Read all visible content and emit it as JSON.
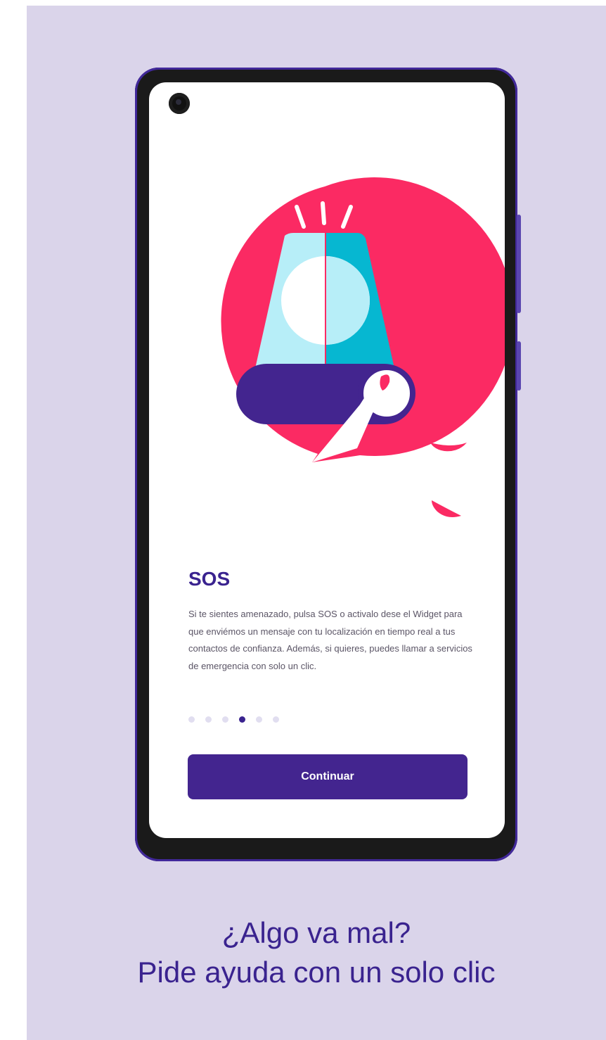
{
  "onboarding": {
    "title": "SOS",
    "description": "Si te sientes amenazado, pulsa SOS o activalo dese el Widget para que enviémos un mensaje con tu localización en tiempo real a tus contactos de confianza. Además, si quieres, puedes llamar a servicios de emergencia con solo un clic.",
    "pagination": {
      "total": 6,
      "current": 4
    },
    "continue_label": "Continuar"
  },
  "caption": {
    "line1": "¿Algo va mal?",
    "line2": "Pide ayuda con un solo clic"
  },
  "colors": {
    "background": "#dad4ea",
    "accent": "#3a238f",
    "button": "#43258f",
    "illustration_red": "#fb2a63",
    "siren_light": "#b7eef8",
    "siren_dark": "#06b7d1"
  },
  "icons": {
    "illustration": "sos-siren-illustration",
    "camera": "front-camera"
  }
}
